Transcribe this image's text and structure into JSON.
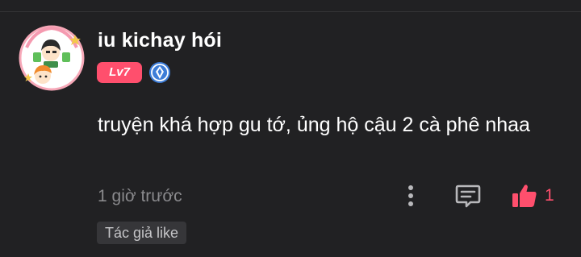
{
  "comment": {
    "username": "iu kichay hói",
    "level_badge": "Lv7",
    "text": "truyện khá hợp gu tớ, ủng hộ cậu 2 cà phê nhaa",
    "timestamp": "1 giờ trước",
    "like_count": "1",
    "author_like_label": "Tác giả like"
  },
  "icons": {
    "more": "more-vertical-icon",
    "reply": "comment-icon",
    "like": "thumbs-up-icon",
    "rank": "diamond-badge-icon"
  },
  "colors": {
    "background": "#212123",
    "accent": "#ff4f6d",
    "badge_blue": "#3d7dd8",
    "muted_text": "#8a8a8d",
    "chip_bg": "#363639"
  }
}
